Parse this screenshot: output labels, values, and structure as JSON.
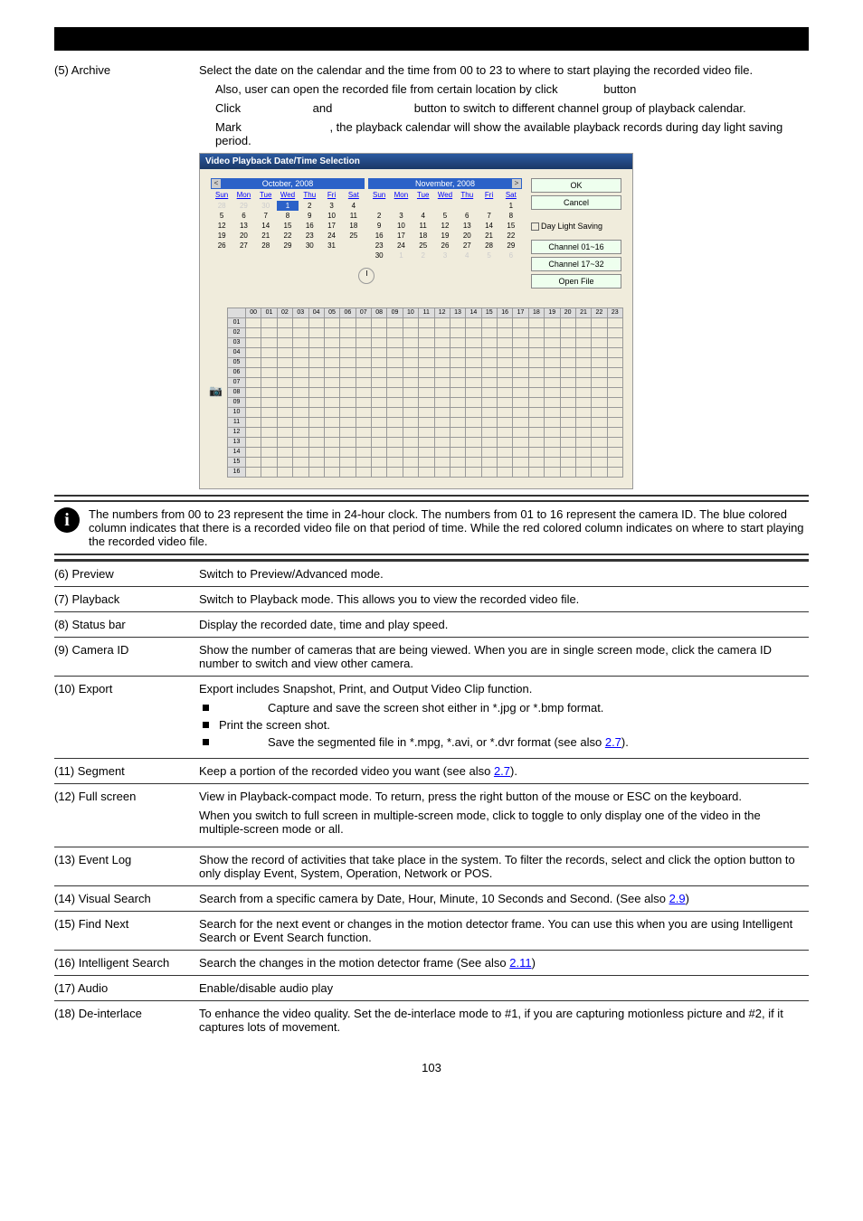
{
  "archive": {
    "label": "(5) Archive",
    "p1": "Select the date on the calendar and the time from 00 to 23 to where to start playing the recorded video file.",
    "p2a": "Also, user can open the recorded file from certain location by click",
    "p2b": "button",
    "p3a": "Click",
    "p3b": "and",
    "p3c": "button to switch to different channel group of playback calendar.",
    "p4a": "Mark",
    "p4b": ", the playback calendar will show the available playback records during day light saving period."
  },
  "calendar": {
    "title": "Video Playback Date/Time Selection",
    "ok": "OK",
    "cancel": "Cancel",
    "dls": "Day Light Saving",
    "c1": "Channel 01~16",
    "c2": "Channel 17~32",
    "open": "Open File",
    "m1": "October, 2008",
    "m2": "November, 2008",
    "days": [
      "Sun",
      "Mon",
      "Tue",
      "Wed",
      "Thu",
      "Fri",
      "Sat"
    ],
    "hours": [
      "00",
      "01",
      "02",
      "03",
      "04",
      "05",
      "06",
      "07",
      "08",
      "09",
      "10",
      "11",
      "12",
      "13",
      "14",
      "15",
      "16",
      "17",
      "18",
      "19",
      "20",
      "21",
      "22",
      "23"
    ],
    "rows": [
      "01",
      "02",
      "03",
      "04",
      "05",
      "06",
      "07",
      "08",
      "09",
      "10",
      "11",
      "12",
      "13",
      "14",
      "15",
      "16"
    ],
    "oct": [
      {
        "n": "28",
        "d": 1
      },
      {
        "n": "29",
        "d": 1
      },
      {
        "n": "30",
        "d": 1
      },
      {
        "n": "1",
        "s": 1
      },
      {
        "n": "2"
      },
      {
        "n": "3"
      },
      {
        "n": "4"
      },
      {
        "n": "5"
      },
      {
        "n": "6"
      },
      {
        "n": "7"
      },
      {
        "n": "8"
      },
      {
        "n": "9"
      },
      {
        "n": "10"
      },
      {
        "n": "11"
      },
      {
        "n": "12"
      },
      {
        "n": "13"
      },
      {
        "n": "14"
      },
      {
        "n": "15"
      },
      {
        "n": "16"
      },
      {
        "n": "17"
      },
      {
        "n": "18"
      },
      {
        "n": "19"
      },
      {
        "n": "20"
      },
      {
        "n": "21"
      },
      {
        "n": "22"
      },
      {
        "n": "23"
      },
      {
        "n": "24"
      },
      {
        "n": "25"
      },
      {
        "n": "26"
      },
      {
        "n": "27"
      },
      {
        "n": "28"
      },
      {
        "n": "29"
      },
      {
        "n": "30"
      },
      {
        "n": "31"
      },
      {
        "n": ""
      }
    ],
    "nov": [
      {
        "n": ""
      },
      {
        "n": ""
      },
      {
        "n": ""
      },
      {
        "n": ""
      },
      {
        "n": ""
      },
      {
        "n": ""
      },
      {
        "n": "1"
      },
      {
        "n": "2"
      },
      {
        "n": "3"
      },
      {
        "n": "4"
      },
      {
        "n": "5"
      },
      {
        "n": "6"
      },
      {
        "n": "7"
      },
      {
        "n": "8"
      },
      {
        "n": "9"
      },
      {
        "n": "10"
      },
      {
        "n": "11"
      },
      {
        "n": "12"
      },
      {
        "n": "13"
      },
      {
        "n": "14"
      },
      {
        "n": "15"
      },
      {
        "n": "16"
      },
      {
        "n": "17"
      },
      {
        "n": "18"
      },
      {
        "n": "19"
      },
      {
        "n": "20"
      },
      {
        "n": "21"
      },
      {
        "n": "22"
      },
      {
        "n": "23"
      },
      {
        "n": "24"
      },
      {
        "n": "25"
      },
      {
        "n": "26"
      },
      {
        "n": "27"
      },
      {
        "n": "28"
      },
      {
        "n": "29"
      },
      {
        "n": "30"
      },
      {
        "n": "1",
        "d": 1
      },
      {
        "n": "2",
        "d": 1
      },
      {
        "n": "3",
        "d": 1
      },
      {
        "n": "4",
        "d": 1
      },
      {
        "n": "5",
        "d": 1
      },
      {
        "n": "6",
        "d": 1
      }
    ]
  },
  "infonote": "The numbers from 00 to 23 represent the time in 24-hour clock. The numbers from 01 to 16 represent the camera ID. The blue colored column indicates that there is a recorded video file on that period of time. While the red colored column indicates on where to start playing the recorded video file.",
  "rows": {
    "6": {
      "l": "(6) Preview",
      "r": "Switch to Preview/Advanced mode."
    },
    "7": {
      "l": "(7) Playback",
      "r": "Switch to Playback mode. This allows you to view the recorded video file."
    },
    "8": {
      "l": "(8) Status bar",
      "r": "Display the recorded date, time and play speed."
    },
    "9": {
      "l": "(9) Camera ID",
      "r": "Show the number of cameras that are being viewed. When you are in single screen mode, click the camera ID number to switch and view other camera."
    },
    "10": {
      "l": "(10) Export",
      "p": "Export includes Snapshot, Print, and Output Video Clip function.",
      "b1": "Capture and save the screen shot either in *.jpg or *.bmp format.",
      "b2": "Print the screen shot.",
      "b3a": "Save the segmented file in *.mpg, *.avi, or *.dvr format (see also ",
      "b3link": "2.7",
      "b3b": ")."
    },
    "11": {
      "l": "(11) Segment",
      "r1": "Keep a portion of the recorded video you want (see also ",
      "link": "2.7",
      "r2": ")."
    },
    "12": {
      "l": "(12) Full screen",
      "p1": "View in Playback-compact mode. To return, press the right button of the mouse or ESC on the keyboard.",
      "p2": "When you switch to full screen in multiple-screen mode,            click to toggle to only display one of the video in the multiple-screen mode or all."
    },
    "13": {
      "l": "(13) Event Log",
      "r": "Show the record of activities that take place in the system. To filter the records, select and click the option button to only display Event, System, Operation, Network or POS."
    },
    "14": {
      "l": "(14) Visual Search",
      "r1": "Search from a specific camera by Date, Hour, Minute, 10 Seconds and Second. (See also ",
      "link": "2.9",
      "r2": ")"
    },
    "15": {
      "l": "(15) Find Next",
      "r": "Search for the next event or changes in the motion detector frame. You can use this when you are using Intelligent Search or Event Search function."
    },
    "16": {
      "l": "(16) Intelligent Search",
      "r1": "Search the changes in the motion detector frame (See also ",
      "link": "2.11",
      "r2": ")"
    },
    "17": {
      "l": "(17) Audio",
      "r": "Enable/disable audio play"
    },
    "18": {
      "l": "(18) De-interlace",
      "r": "To enhance the video quality. Set the de-interlace mode to #1, if you are capturing motionless picture and #2, if it captures lots of movement."
    }
  },
  "page": "103"
}
